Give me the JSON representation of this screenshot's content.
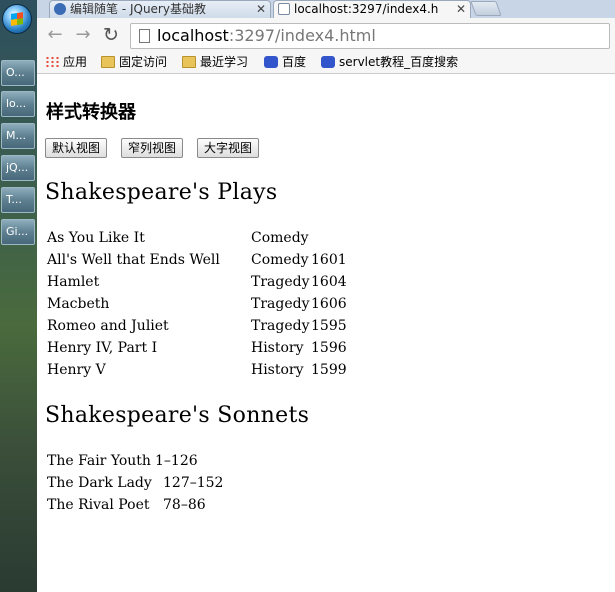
{
  "taskbar": {
    "items": [
      "O...",
      "lo...",
      "M...",
      "jQ...",
      "T...",
      "Gi..."
    ]
  },
  "browser": {
    "tabs": [
      {
        "label": "编辑随笔 - JQuery基础教",
        "active": false
      },
      {
        "label": "localhost:3297/index4.h",
        "active": true
      }
    ],
    "url_host": "localhost",
    "url_rest": ":3297/index4.html",
    "bookmarks": [
      "应用",
      "固定访问",
      "最近学习",
      "百度",
      "servlet教程_百度搜索"
    ]
  },
  "page": {
    "title": "样式转换器",
    "buttons": [
      "默认视图",
      "窄列视图",
      "大字视图"
    ],
    "plays_heading": "Shakespeare's Plays",
    "plays": [
      {
        "title": "As You Like It",
        "genre": "Comedy",
        "year": ""
      },
      {
        "title": "All's Well that Ends Well",
        "genre": "Comedy",
        "year": "1601"
      },
      {
        "title": "Hamlet",
        "genre": "Tragedy",
        "year": "1604"
      },
      {
        "title": "Macbeth",
        "genre": "Tragedy",
        "year": "1606"
      },
      {
        "title": "Romeo and Juliet",
        "genre": "Tragedy",
        "year": "1595"
      },
      {
        "title": "Henry IV, Part I",
        "genre": "History",
        "year": "1596"
      },
      {
        "title": "Henry V",
        "genre": "History",
        "year": "1599"
      }
    ],
    "sonnets_heading": "Shakespeare's Sonnets",
    "sonnets": [
      {
        "title": "The Fair Youth",
        "range": "1–126"
      },
      {
        "title": "The Dark Lady",
        "range": "127–152"
      },
      {
        "title": "The Rival Poet",
        "range": "78–86"
      }
    ]
  }
}
